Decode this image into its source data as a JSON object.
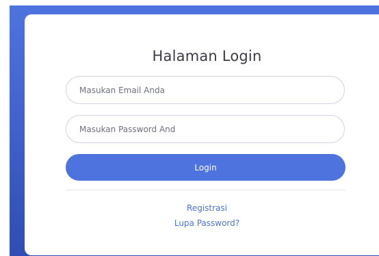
{
  "login": {
    "title": "Halaman Login",
    "email_placeholder": "Masukan Email Anda",
    "password_placeholder": "Masukan Password And",
    "login_label": "Login",
    "register_link": "Registrasi",
    "forgot_link": "Lupa Password?"
  },
  "colors": {
    "primary": "#4e73df",
    "text": "#3a3b45",
    "border": "#d1d3e2"
  }
}
